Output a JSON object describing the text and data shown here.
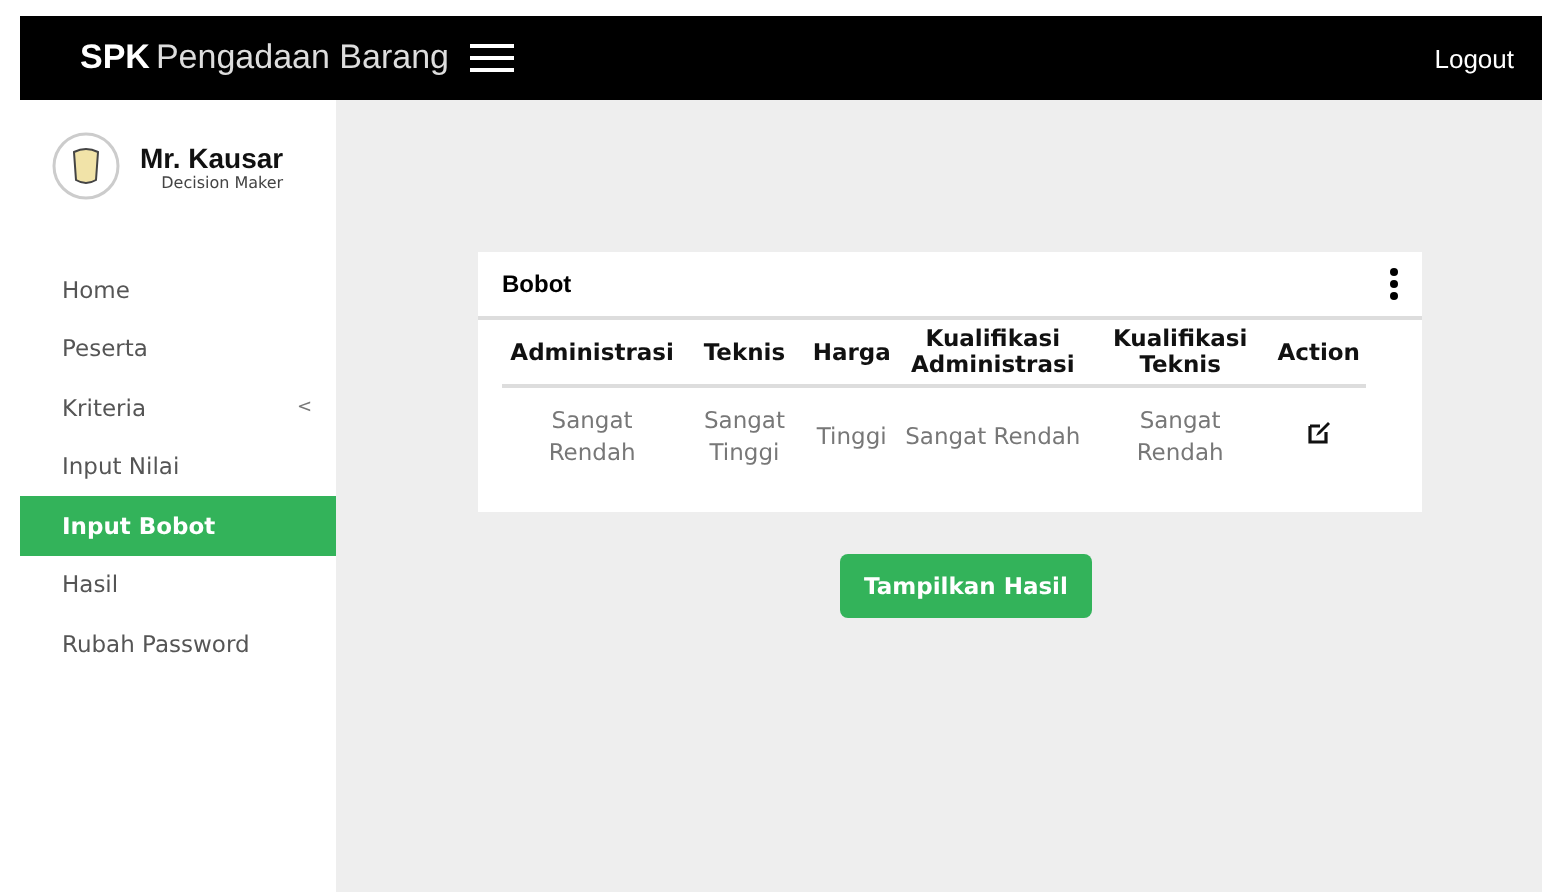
{
  "header": {
    "brand": "SPK",
    "title": "Pengadaan Barang",
    "logout": "Logout"
  },
  "user": {
    "name": "Mr. Kausar",
    "role": "Decision Maker"
  },
  "sidebar": {
    "items": [
      {
        "label": "Home",
        "selected": false
      },
      {
        "label": "Peserta",
        "selected": false
      },
      {
        "label": "Kriteria",
        "selected": false,
        "caret": "<"
      },
      {
        "label": "Input Nilai",
        "selected": false
      },
      {
        "label": "Input Bobot",
        "selected": true
      },
      {
        "label": "Hasil",
        "selected": false
      },
      {
        "label": "Rubah Password",
        "selected": false
      }
    ]
  },
  "card": {
    "title": "Bobot",
    "table": {
      "columns": [
        "Administrasi",
        "Teknis",
        "Harga",
        "Kualifikasi Administrasi",
        "Kualifikasi Teknis",
        "Action"
      ],
      "rows": [
        [
          "Sangat Rendah",
          "Sangat Tinggi",
          "Tinggi",
          "Sangat Rendah",
          "Sangat Rendah"
        ]
      ]
    }
  },
  "button": "Tampilkan Hasil"
}
